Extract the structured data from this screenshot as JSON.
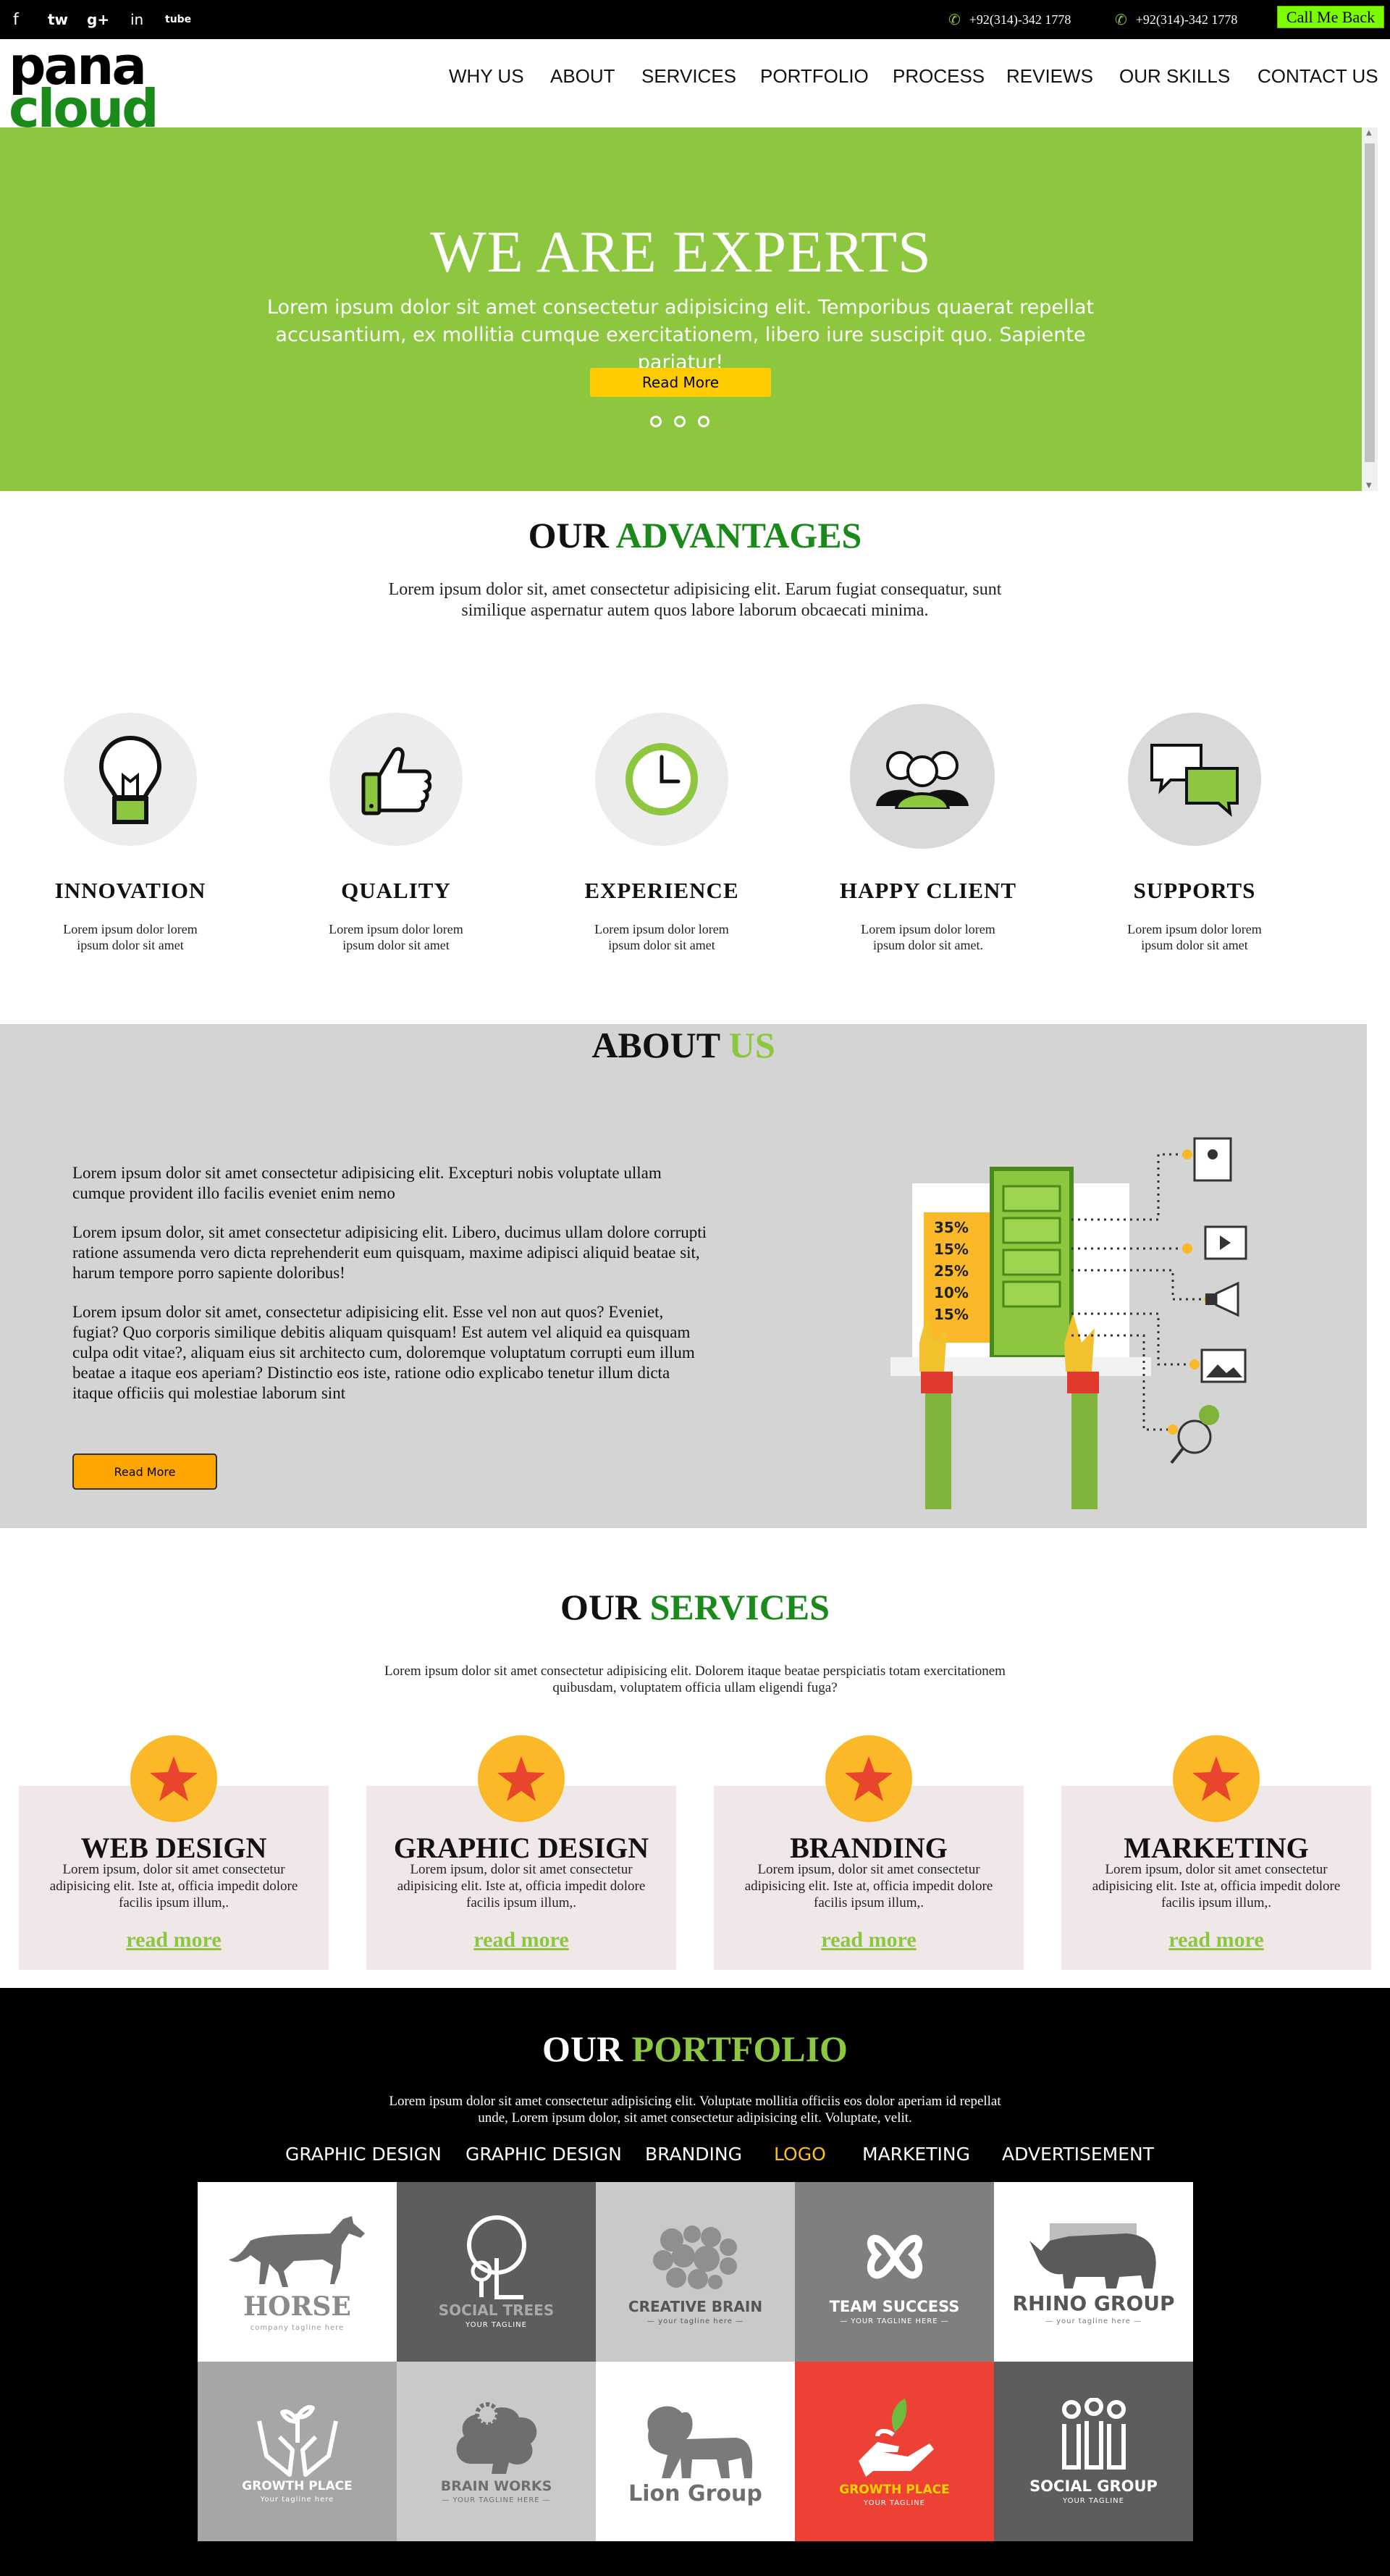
{
  "topbar": {
    "social": [
      "f",
      "tw",
      "g+",
      "in",
      "tube"
    ],
    "phones": [
      "+92(314)-342 1778",
      "+92(314)-342 1778"
    ],
    "callback_label": "Call Me Back"
  },
  "header": {
    "logo_line1": "pana",
    "logo_line2": "cloud",
    "nav": [
      "WHY US",
      "ABOUT",
      "SERVICES",
      "PORTFOLIO",
      "PROCESS",
      "REVIEWS",
      "OUR SKILLS",
      "CONTACT US"
    ]
  },
  "hero": {
    "title": "WE ARE EXPERTS",
    "text": "Lorem ipsum dolor sit amet consectetur adipisicing elit. Temporibus quaerat repellat accusantium, ex mollitia cumque exercitationem, libero iure suscipit quo. Sapiente pariatur!",
    "button": "Read More",
    "slides": 3
  },
  "advantages": {
    "title_a": "OUR",
    "title_b": "ADVANTAGES",
    "subtitle": "Lorem ipsum dolor sit, amet consectetur adipisicing elit. Earum fugiat consequatur, sunt similique aspernatur autem quos labore laborum obcaecati minima.",
    "items": [
      {
        "title": "INNOVATION",
        "text": "Lorem ipsum dolor lorem ipsum dolor sit amet",
        "icon": "lightbulb-icon"
      },
      {
        "title": "QUALITY",
        "text": "Lorem ipsum dolor lorem ipsum dolor sit amet",
        "icon": "thumbs-up-icon"
      },
      {
        "title": "EXPERIENCE",
        "text": "Lorem ipsum dolor lorem ipsum dolor sit amet",
        "icon": "clock-icon"
      },
      {
        "title": "HAPPY CLIENT",
        "text": "Lorem ipsum dolor lorem ipsum dolor sit amet.",
        "icon": "users-icon"
      },
      {
        "title": "SUPPORTS",
        "text": "Lorem ipsum dolor lorem ipsum dolor sit amet",
        "icon": "chat-icon"
      }
    ]
  },
  "about": {
    "title_a": "ABOUT",
    "title_b": "US",
    "paragraphs": [
      "Lorem ipsum dolor sit amet consectetur adipisicing elit. Excepturi nobis voluptate ullam cumque provident illo facilis eveniet enim nemo",
      "Lorem ipsum dolor, sit amet consectetur adipisicing elit. Libero, ducimus ullam dolore corrupti ratione assumenda vero dicta reprehenderit eum quisquam, maxime adipisci aliquid beatae sit, harum tempore porro sapiente doloribus!",
      "Lorem ipsum dolor sit amet, consectetur adipisicing elit. Esse vel non aut quos? Eveniet, fugiat? Quo corporis similique debitis aliquam quisquam! Est autem vel aliquid ea quisquam culpa odit vitae?, aliquam eius sit architecto cum, doloremque voluptatum corrupti eum illum beatae a itaque eos aperiam? Distinctio eos iste, ratione odio explicabo tenetur illum dicta itaque officiis qui molestiae laborum sint"
    ],
    "button": "Read More",
    "chart_labels": [
      "35%",
      "15%",
      "25%",
      "10%",
      "15%"
    ]
  },
  "services": {
    "title_a": "OUR",
    "title_b": "SERVICES",
    "subtitle": "Lorem ipsum dolor sit amet consectetur adipisicing elit. Dolorem itaque beatae perspiciatis totam exercitationem quibusdam, voluptatem officia ullam eligendi fuga?",
    "items": [
      {
        "title": "WEB DESIGN",
        "text": "Lorem ipsum, dolor sit amet consectetur adipisicing elit. Iste at, officia impedit dolore facilis ipsum illum,.",
        "link": "read more"
      },
      {
        "title": "GRAPHIC DESIGN",
        "text": "Lorem ipsum, dolor sit amet consectetur adipisicing elit. Iste at, officia impedit dolore facilis ipsum illum,.",
        "link": "read more"
      },
      {
        "title": "BRANDING",
        "text": "Lorem ipsum, dolor sit amet consectetur adipisicing elit. Iste at, officia impedit dolore facilis ipsum illum,.",
        "link": "read more"
      },
      {
        "title": "MARKETING",
        "text": "Lorem ipsum, dolor sit amet consectetur adipisicing elit. Iste at, officia impedit dolore facilis ipsum illum,.",
        "link": "read more"
      }
    ]
  },
  "portfolio": {
    "title_a": "OUR",
    "title_b": "PORTFOLIO",
    "subtitle": "Lorem ipsum dolor sit amet consectetur adipisicing elit. Voluptate mollitia officiis eos dolor aperiam id repellat unde, Lorem ipsum dolor, sit amet consectetur adipisicing elit. Voluptate, velit.",
    "filters": [
      "GRAPHIC DESIGN",
      "GRAPHIC DESIGN",
      "BRANDING",
      "LOGO",
      "MARKETING",
      "ADVERTISEMENT"
    ],
    "active_filter_color": "#ffc20e",
    "tiles": [
      {
        "name": "HORSE",
        "tag": "company tagline here"
      },
      {
        "name": "SOCIAL TREES",
        "tag": "YOUR TAGLINE"
      },
      {
        "name": "CREATIVE BRAIN",
        "tag": "— your tagline here —"
      },
      {
        "name": "TEAM SUCCESS",
        "tag": "— YOUR TAGLINE HERE —"
      },
      {
        "name": "RHINO GROUP",
        "tag": "— your tagline here —"
      },
      {
        "name": "GROWTH PLACE",
        "tag": "Your tagline here"
      },
      {
        "name": "BRAIN WORKS",
        "tag": "— YOUR TAGLINE HERE —"
      },
      {
        "name": "Lion Group",
        "tag": ""
      },
      {
        "name": "GROWTH PLACE",
        "tag": "YOUR TAGLINE"
      },
      {
        "name": "SOCIAL GROUP",
        "tag": "YOUR TAGLINE"
      }
    ]
  },
  "colors": {
    "accent_green": "#8dc63f",
    "dark_green": "#1a8a1a",
    "yellow": "#ffcc00",
    "orange": "#fbb929"
  }
}
